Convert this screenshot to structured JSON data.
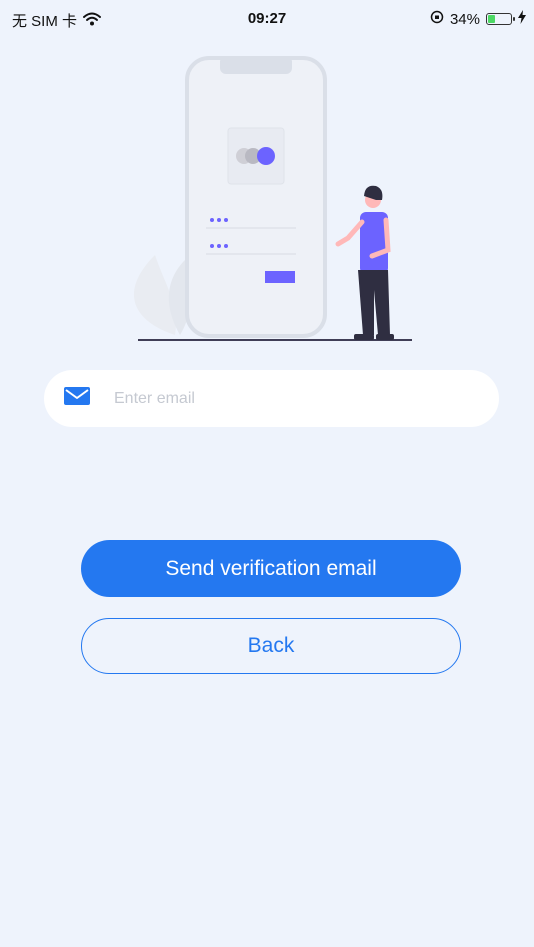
{
  "status_bar": {
    "carrier": "无 SIM 卡",
    "time": "09:27",
    "battery_percent": "34%",
    "battery_level": 0.34
  },
  "form": {
    "email_placeholder": "Enter email",
    "email_value": ""
  },
  "buttons": {
    "send_label": "Send verification email",
    "back_label": "Back"
  },
  "colors": {
    "background": "#eef3fc",
    "primary": "#2478f0",
    "illustration_accent": "#6c63ff"
  },
  "icons": {
    "wifi": "wifi-icon",
    "orientation_lock": "orientation-lock-icon",
    "battery": "battery-icon",
    "charging": "charging-icon",
    "email": "envelope-icon"
  }
}
